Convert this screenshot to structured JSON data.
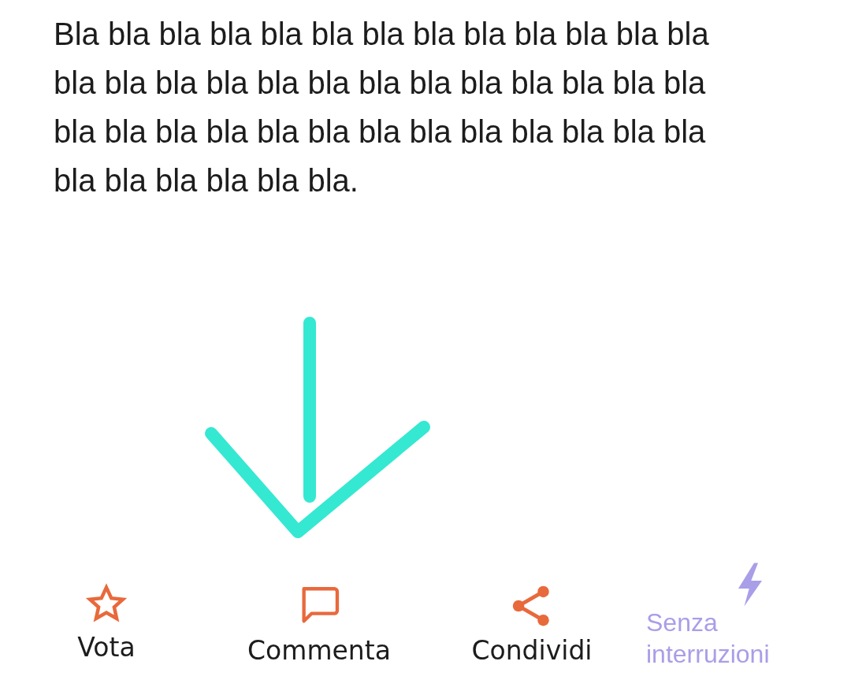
{
  "paragraph": "Bla bla bla bla bla bla bla bla bla bla bla bla bla bla bla bla bla bla bla bla bla bla bla bla bla bla bla bla bla bla bla bla bla bla bla bla bla bla bla bla bla bla bla bla bla.",
  "actions": [
    {
      "kind": "star",
      "label": "Vota",
      "color": "#e8693c"
    },
    {
      "kind": "comment",
      "label": "Commenta",
      "color": "#e8693c"
    },
    {
      "kind": "share",
      "label": "Condividi",
      "color": "#e8693c"
    },
    {
      "kind": "bolt",
      "label": "Senza interruzioni",
      "color": "#a99ee8"
    }
  ]
}
